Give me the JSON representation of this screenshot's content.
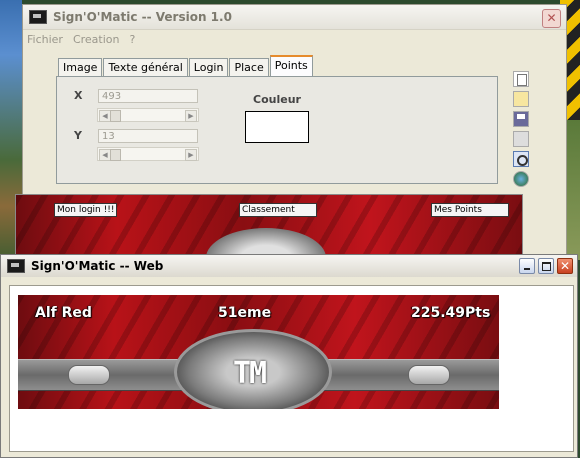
{
  "main_window": {
    "title": "Sign'O'Matic -- Version 1.0",
    "menu": [
      "Fichier",
      "Creation",
      "?"
    ],
    "tabs": [
      "Image",
      "Texte général",
      "Login",
      "Place",
      "Points"
    ],
    "active_tab": "Points",
    "x_label": "X",
    "x_value": "493",
    "y_label": "Y",
    "y_value": "13",
    "color_label": "Couleur",
    "color_value": "#ffffff",
    "preview": {
      "login": "Mon login !!!",
      "rank": "Classement",
      "points": "Mes Points"
    },
    "toolbar_icons": [
      "new-file-icon",
      "open-folder-icon",
      "save-icon",
      "print-icon",
      "preview-icon",
      "web-icon"
    ]
  },
  "web_window": {
    "title": "Sign'O'Matic -- Web",
    "banner": {
      "login": "Alf Red",
      "rank": "51eme",
      "points": "225.49Pts",
      "logo": "TM"
    }
  }
}
